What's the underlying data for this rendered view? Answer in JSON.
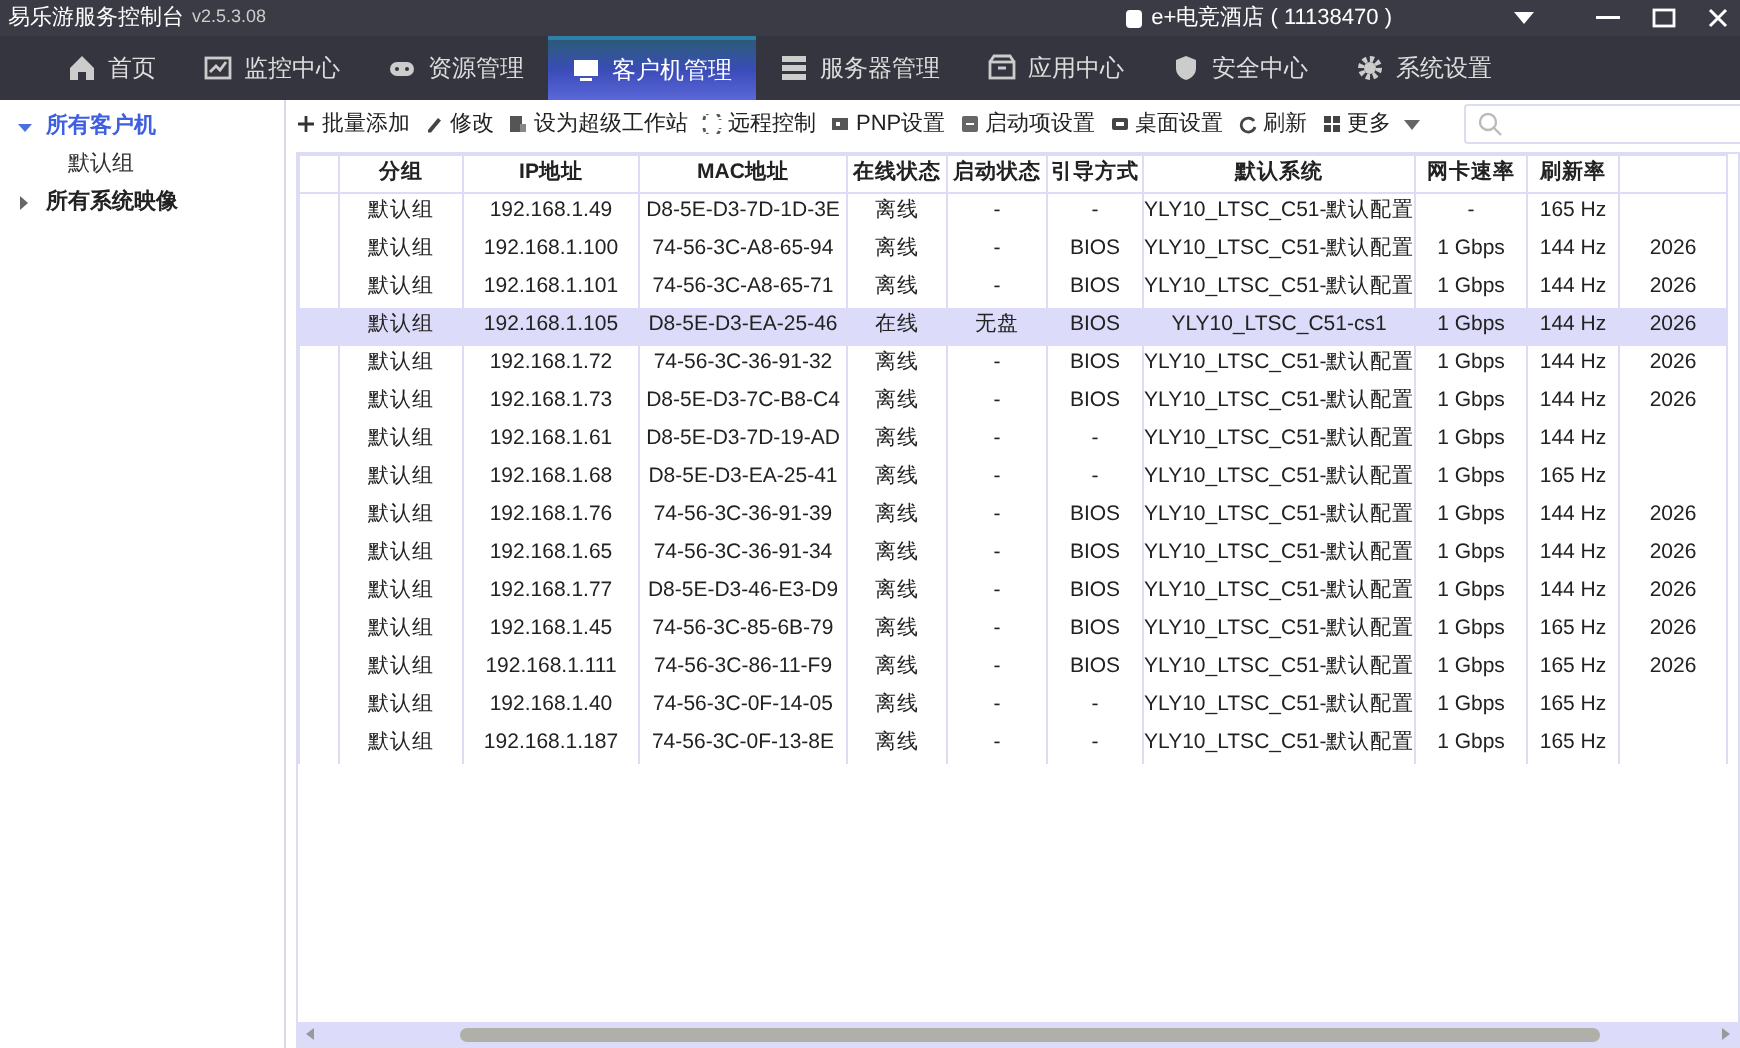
{
  "window": {
    "title": "易乐游服务控制台",
    "version": "v2.5.3.08",
    "account": "e+电竞酒店 ( 11138470 )"
  },
  "nav": [
    {
      "label": "首页",
      "selected": false
    },
    {
      "label": "监控中心",
      "selected": false
    },
    {
      "label": "资源管理",
      "selected": false
    },
    {
      "label": "客户机管理",
      "selected": true
    },
    {
      "label": "服务器管理",
      "selected": false
    },
    {
      "label": "应用中心",
      "selected": false
    },
    {
      "label": "安全中心",
      "selected": false
    },
    {
      "label": "系统设置",
      "selected": false
    }
  ],
  "sidebar": {
    "items": [
      {
        "label": "所有客户机",
        "expanded": true,
        "selected": true,
        "children": [
          {
            "label": "默认组",
            "selected": false
          }
        ]
      },
      {
        "label": "所有系统映像",
        "expanded": false,
        "selected": false
      }
    ]
  },
  "toolbar": [
    "批量添加",
    "修改",
    "设为超级工作站",
    "远程控制",
    "PNP设置",
    "启动项设置",
    "桌面设置",
    "刷新",
    "更多"
  ],
  "table": {
    "columns": [
      "",
      "分组",
      "IP地址",
      "MAC地址",
      "在线状态",
      "启动状态",
      "引导方式",
      "默认系统",
      "网卡速率",
      "刷新率",
      ""
    ],
    "rows": [
      {
        "selected": false,
        "cells": [
          "",
          "默认组",
          "192.168.1.49",
          "D8-5E-D3-7D-1D-3E",
          "离线",
          "-",
          "-",
          "YLY10_LTSC_C51-默认配置",
          "-",
          "165 Hz",
          ""
        ]
      },
      {
        "selected": false,
        "cells": [
          "",
          "默认组",
          "192.168.1.100",
          "74-56-3C-A8-65-94",
          "离线",
          "-",
          "BIOS",
          "YLY10_LTSC_C51-默认配置",
          "1 Gbps",
          "144 Hz",
          "2026"
        ]
      },
      {
        "selected": false,
        "cells": [
          "",
          "默认组",
          "192.168.1.101",
          "74-56-3C-A8-65-71",
          "离线",
          "-",
          "BIOS",
          "YLY10_LTSC_C51-默认配置",
          "1 Gbps",
          "144 Hz",
          "2026"
        ]
      },
      {
        "selected": true,
        "cells": [
          "",
          "默认组",
          "192.168.1.105",
          "D8-5E-D3-EA-25-46",
          "在线",
          "无盘",
          "BIOS",
          "YLY10_LTSC_C51-cs1",
          "1 Gbps",
          "144 Hz",
          "2026"
        ]
      },
      {
        "selected": false,
        "cells": [
          "",
          "默认组",
          "192.168.1.72",
          "74-56-3C-36-91-32",
          "离线",
          "-",
          "BIOS",
          "YLY10_LTSC_C51-默认配置",
          "1 Gbps",
          "144 Hz",
          "2026"
        ]
      },
      {
        "selected": false,
        "cells": [
          "",
          "默认组",
          "192.168.1.73",
          "D8-5E-D3-7C-B8-C4",
          "离线",
          "-",
          "BIOS",
          "YLY10_LTSC_C51-默认配置",
          "1 Gbps",
          "144 Hz",
          "2026"
        ]
      },
      {
        "selected": false,
        "cells": [
          "",
          "默认组",
          "192.168.1.61",
          "D8-5E-D3-7D-19-AD",
          "离线",
          "-",
          "-",
          "YLY10_LTSC_C51-默认配置",
          "1 Gbps",
          "144 Hz",
          ""
        ]
      },
      {
        "selected": false,
        "cells": [
          "",
          "默认组",
          "192.168.1.68",
          "D8-5E-D3-EA-25-41",
          "离线",
          "-",
          "-",
          "YLY10_LTSC_C51-默认配置",
          "1 Gbps",
          "165 Hz",
          ""
        ]
      },
      {
        "selected": false,
        "cells": [
          "",
          "默认组",
          "192.168.1.76",
          "74-56-3C-36-91-39",
          "离线",
          "-",
          "BIOS",
          "YLY10_LTSC_C51-默认配置",
          "1 Gbps",
          "144 Hz",
          "2026"
        ]
      },
      {
        "selected": false,
        "cells": [
          "",
          "默认组",
          "192.168.1.65",
          "74-56-3C-36-91-34",
          "离线",
          "-",
          "BIOS",
          "YLY10_LTSC_C51-默认配置",
          "1 Gbps",
          "144 Hz",
          "2026"
        ]
      },
      {
        "selected": false,
        "cells": [
          "",
          "默认组",
          "192.168.1.77",
          "D8-5E-D3-46-E3-D9",
          "离线",
          "-",
          "BIOS",
          "YLY10_LTSC_C51-默认配置",
          "1 Gbps",
          "144 Hz",
          "2026"
        ]
      },
      {
        "selected": false,
        "cells": [
          "",
          "默认组",
          "192.168.1.45",
          "74-56-3C-85-6B-79",
          "离线",
          "-",
          "BIOS",
          "YLY10_LTSC_C51-默认配置",
          "1 Gbps",
          "165 Hz",
          "2026"
        ]
      },
      {
        "selected": false,
        "cells": [
          "",
          "默认组",
          "192.168.1.111",
          "74-56-3C-86-11-F9",
          "离线",
          "-",
          "BIOS",
          "YLY10_LTSC_C51-默认配置",
          "1 Gbps",
          "165 Hz",
          "2026"
        ]
      },
      {
        "selected": false,
        "cells": [
          "",
          "默认组",
          "192.168.1.40",
          "74-56-3C-0F-14-05",
          "离线",
          "-",
          "-",
          "YLY10_LTSC_C51-默认配置",
          "1 Gbps",
          "165 Hz",
          ""
        ]
      },
      {
        "selected": false,
        "cells": [
          "",
          "默认组",
          "192.168.1.187",
          "74-56-3C-0F-13-8E",
          "离线",
          "-",
          "-",
          "YLY10_LTSC_C51-默认配置",
          "1 Gbps",
          "165 Hz",
          ""
        ]
      }
    ]
  }
}
